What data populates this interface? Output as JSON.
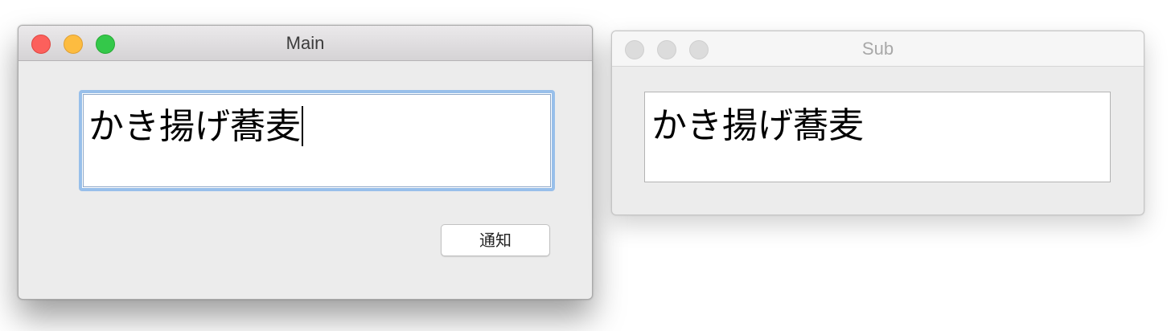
{
  "main_window": {
    "title": "Main",
    "text_field": {
      "value": "かき揚げ蕎麦",
      "focused": true
    },
    "notify_button": {
      "label": "通知"
    },
    "traffic_lights": {
      "close_color": "#fc605c",
      "minimize_color": "#fdbc40",
      "zoom_color": "#34c84a"
    }
  },
  "sub_window": {
    "title": "Sub",
    "text_field": {
      "value": "かき揚げ蕎麦"
    },
    "traffic_lights": {
      "inactive_color": "#dcdcdc"
    }
  },
  "colors": {
    "focus_ring": "#98bfea",
    "window_background": "#ececec"
  }
}
